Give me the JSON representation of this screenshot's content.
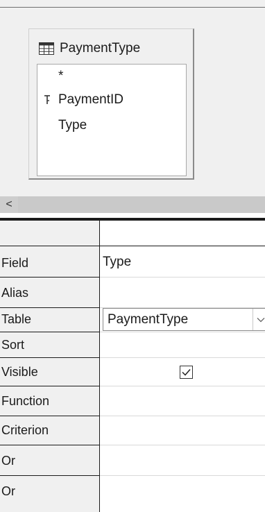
{
  "design_pane": {
    "table": {
      "icon": "table-grid-icon",
      "title": "PaymentType",
      "fields": [
        {
          "name": "*",
          "icon": ""
        },
        {
          "name": "PaymentID",
          "icon": "primary-key-icon"
        },
        {
          "name": "Type",
          "icon": ""
        }
      ]
    },
    "scrollbar": {
      "left_arrow": "<"
    }
  },
  "query_grid": {
    "rows": [
      {
        "label": "Field",
        "value": "Type"
      },
      {
        "label": "Alias",
        "value": ""
      },
      {
        "label": "Table",
        "value": "PaymentType"
      },
      {
        "label": "Sort",
        "value": ""
      },
      {
        "label": "Visible",
        "value": "checked"
      },
      {
        "label": "Function",
        "value": ""
      },
      {
        "label": "Criterion",
        "value": ""
      },
      {
        "label": "Or",
        "value": ""
      },
      {
        "label": "Or",
        "value": ""
      }
    ]
  }
}
